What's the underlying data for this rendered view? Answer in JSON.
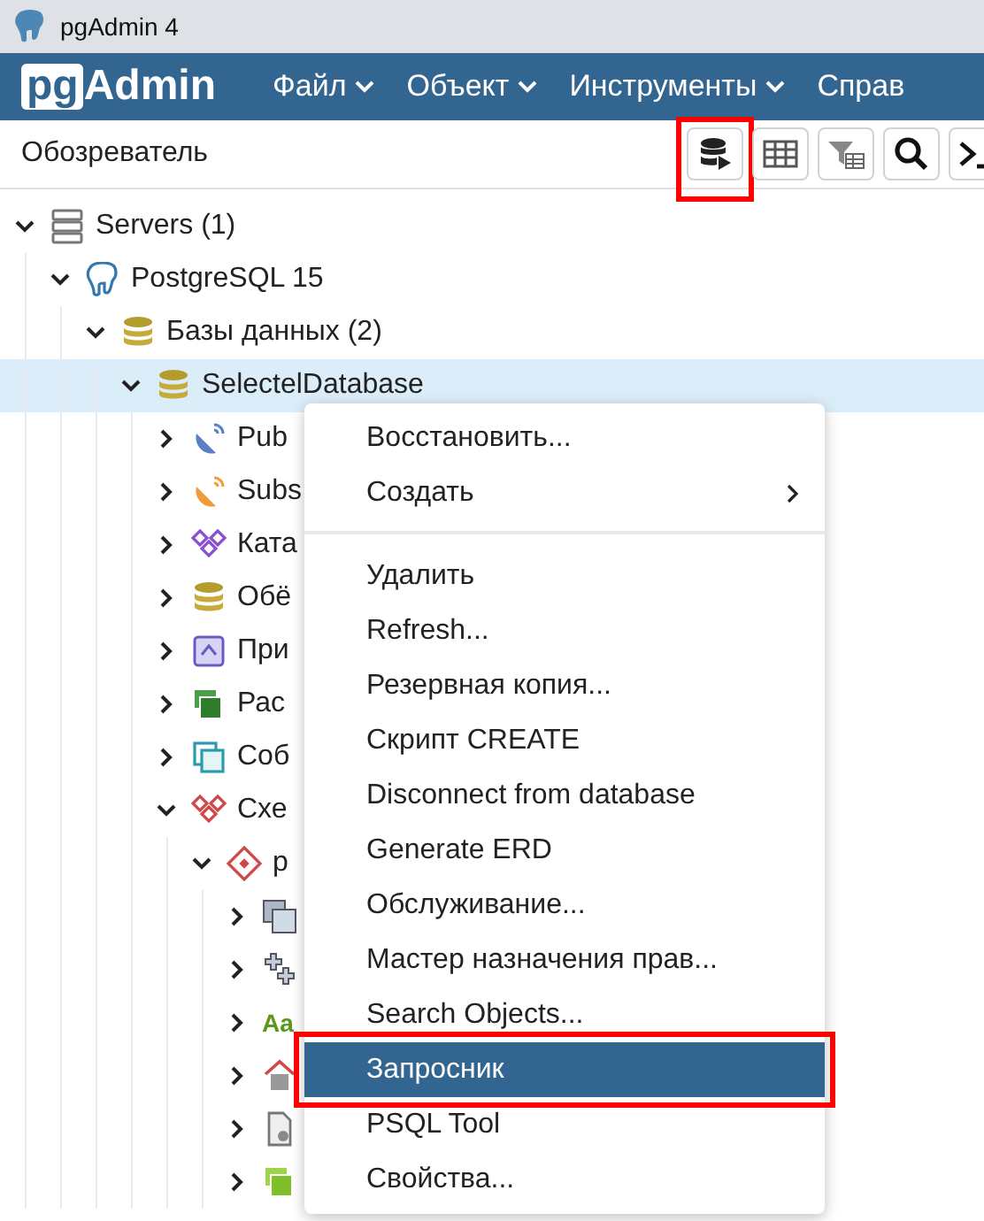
{
  "window": {
    "title": "pgAdmin 4"
  },
  "navbar": {
    "logo_left": "pg",
    "logo_right": "Admin",
    "menus": [
      {
        "label": "Файл",
        "caret": true
      },
      {
        "label": "Объект",
        "caret": true
      },
      {
        "label": "Инструменты",
        "caret": true
      },
      {
        "label": "Справ",
        "caret": false
      }
    ]
  },
  "toolbar": {
    "title": "Обозреватель",
    "buttons": [
      {
        "kind": "query",
        "highlighted": true
      },
      {
        "kind": "table",
        "highlighted": false
      },
      {
        "kind": "filter",
        "highlighted": false
      },
      {
        "kind": "search",
        "highlighted": false
      },
      {
        "kind": "terminal",
        "highlighted": false
      }
    ]
  },
  "tree": [
    {
      "label": "Servers (1)",
      "kind": "servers",
      "expanded": true,
      "selected": false,
      "children": [
        {
          "label": "PostgreSQL 15",
          "kind": "server",
          "expanded": true,
          "selected": false,
          "children": [
            {
              "label": "Базы данных (2)",
              "kind": "databases",
              "expanded": true,
              "selected": false,
              "children": [
                {
                  "label": "SelectelDatabase",
                  "kind": "database",
                  "expanded": true,
                  "selected": true,
                  "children": [
                    {
                      "label": "Pub",
                      "kind": "publications",
                      "expanded": false,
                      "selected": false
                    },
                    {
                      "label": "Subs",
                      "kind": "subscriptions",
                      "expanded": false,
                      "selected": false
                    },
                    {
                      "label": "Ката",
                      "kind": "catalogs",
                      "expanded": false,
                      "selected": false
                    },
                    {
                      "label": "Обё",
                      "kind": "fdw",
                      "expanded": false,
                      "selected": false
                    },
                    {
                      "label": "При",
                      "kind": "extensions",
                      "expanded": false,
                      "selected": false
                    },
                    {
                      "label": "Рас",
                      "kind": "languages",
                      "expanded": false,
                      "selected": false
                    },
                    {
                      "label": "Соб",
                      "kind": "triggers",
                      "expanded": false,
                      "selected": false
                    },
                    {
                      "label": "Схе",
                      "kind": "schemas",
                      "expanded": true,
                      "selected": false,
                      "children": [
                        {
                          "label": "p",
                          "kind": "schema",
                          "expanded": true,
                          "selected": false,
                          "children": [
                            {
                              "kind": "aggregates",
                              "expanded": false,
                              "selected": false
                            },
                            {
                              "kind": "operators",
                              "expanded": false,
                              "selected": false
                            },
                            {
                              "kind": "collations",
                              "icon_text": "Aa",
                              "expanded": false,
                              "selected": false
                            },
                            {
                              "kind": "domains",
                              "expanded": false,
                              "selected": false
                            },
                            {
                              "kind": "configs",
                              "expanded": false,
                              "selected": false
                            },
                            {
                              "kind": "dictionaries",
                              "expanded": false,
                              "selected": false
                            }
                          ]
                        }
                      ]
                    }
                  ]
                }
              ]
            }
          ]
        }
      ]
    }
  ],
  "context_menu": {
    "items": [
      {
        "label": "Восстановить...",
        "submenu": false,
        "selected": false,
        "highlighted": false
      },
      {
        "label": "Создать",
        "submenu": true,
        "selected": false,
        "highlighted": false,
        "divider_after": true
      },
      {
        "label": "Удалить",
        "submenu": false,
        "selected": false,
        "highlighted": false
      },
      {
        "label": "Refresh...",
        "submenu": false,
        "selected": false,
        "highlighted": false
      },
      {
        "label": "Резервная копия...",
        "submenu": false,
        "selected": false,
        "highlighted": false
      },
      {
        "label": "Скрипт CREATE",
        "submenu": false,
        "selected": false,
        "highlighted": false
      },
      {
        "label": "Disconnect from database",
        "submenu": false,
        "selected": false,
        "highlighted": false
      },
      {
        "label": "Generate ERD",
        "submenu": false,
        "selected": false,
        "highlighted": false
      },
      {
        "label": "Обслуживание...",
        "submenu": false,
        "selected": false,
        "highlighted": false
      },
      {
        "label": "Мастер назначения прав...",
        "submenu": false,
        "selected": false,
        "highlighted": false
      },
      {
        "label": "Search Objects...",
        "submenu": false,
        "selected": false,
        "highlighted": false
      },
      {
        "label": "Запросник",
        "submenu": false,
        "selected": true,
        "highlighted": true
      },
      {
        "label": "PSQL Tool",
        "submenu": false,
        "selected": false,
        "highlighted": false
      },
      {
        "label": "Свойства...",
        "submenu": false,
        "selected": false,
        "highlighted": false
      }
    ]
  }
}
